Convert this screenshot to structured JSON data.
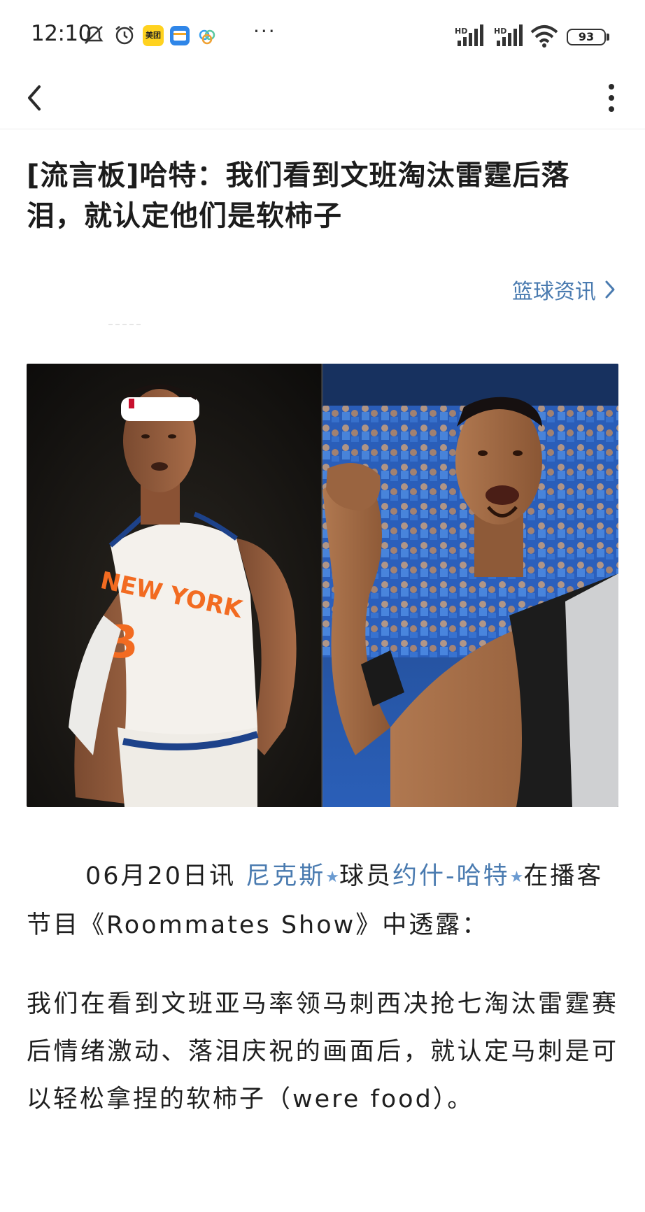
{
  "status_bar": {
    "time": "12:10",
    "app_icons": [
      "mute-icon",
      "alarm-icon",
      "meituan-icon",
      "wallet-icon",
      "cloud-icon"
    ],
    "meituan_label": "美团",
    "more": "···",
    "network_1": "HD",
    "network_2": "HD",
    "battery": "93"
  },
  "nav": {
    "back_icon": "chevron-left-icon",
    "menu_icon": "more-vertical-icon"
  },
  "article": {
    "title": "[流言板]哈特：我们看到文班淘汰雷霆后落泪，就认定他们是软柿子",
    "category": "篮球资讯",
    "p1_prefix": "06月20日讯 ",
    "team_link": "尼克斯",
    "p1_mid": "球员",
    "player_link": "约什-哈特",
    "p1_suffix": "在播客节目《Roommates Show》中透露：",
    "p2": "我们在看到文班亚马率领马刺西决抢七淘汰雷霆赛后情绪激动、落泪庆祝的画面后，就认定马刺是可以轻松拿捏的软柿子（were food）。"
  },
  "colors": {
    "link": "#4a7bb0",
    "title": "#1c1c1c",
    "body": "#1f1f1f",
    "knicks_orange": "#f26b21",
    "knicks_blue": "#1d428a",
    "thunder_blue": "#2b6fd6"
  }
}
